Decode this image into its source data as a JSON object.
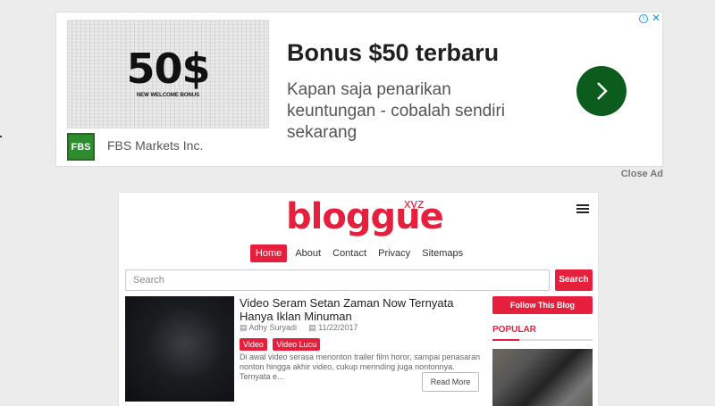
{
  "ad": {
    "image_big_text": "50$",
    "image_small_text": "NEW WELCOME BONUS",
    "logo_text": "FBS",
    "company": "FBS Markets Inc.",
    "headline": "Bonus $50 terbaru",
    "body": "Kapan saja penarikan keuntungan - cobalah sendiri sekarang",
    "info_icon": "i",
    "close_icon": "✕",
    "close_label": "Close Ad",
    "cta_color": "#0c5c1e"
  },
  "blog": {
    "logo": "bloggue",
    "logo_suffix": "xyz",
    "accent_color": "#e61f3d",
    "nav": [
      {
        "label": "Home",
        "active": true
      },
      {
        "label": "About"
      },
      {
        "label": "Contact"
      },
      {
        "label": "Privacy"
      },
      {
        "label": "Sitemaps"
      }
    ],
    "search": {
      "placeholder": "Search",
      "button": "Search"
    },
    "post": {
      "title": "Video Seram Setan Zaman Now Ternyata Hanya Iklan Minuman",
      "author": "Adhy Suryadi",
      "date": "11/22/2017",
      "tags": [
        "Video",
        "Video Lucu"
      ],
      "excerpt": "Di awal video serasa menonton trailer film horor, sampai penasaran nonton hingga akhir video, cukup merinding juga nontonnya. Ternyata e...",
      "read_more": "Read More"
    },
    "sidebar": {
      "follow_button": "Follow This Blog",
      "popular_heading": "POPULAR"
    }
  }
}
